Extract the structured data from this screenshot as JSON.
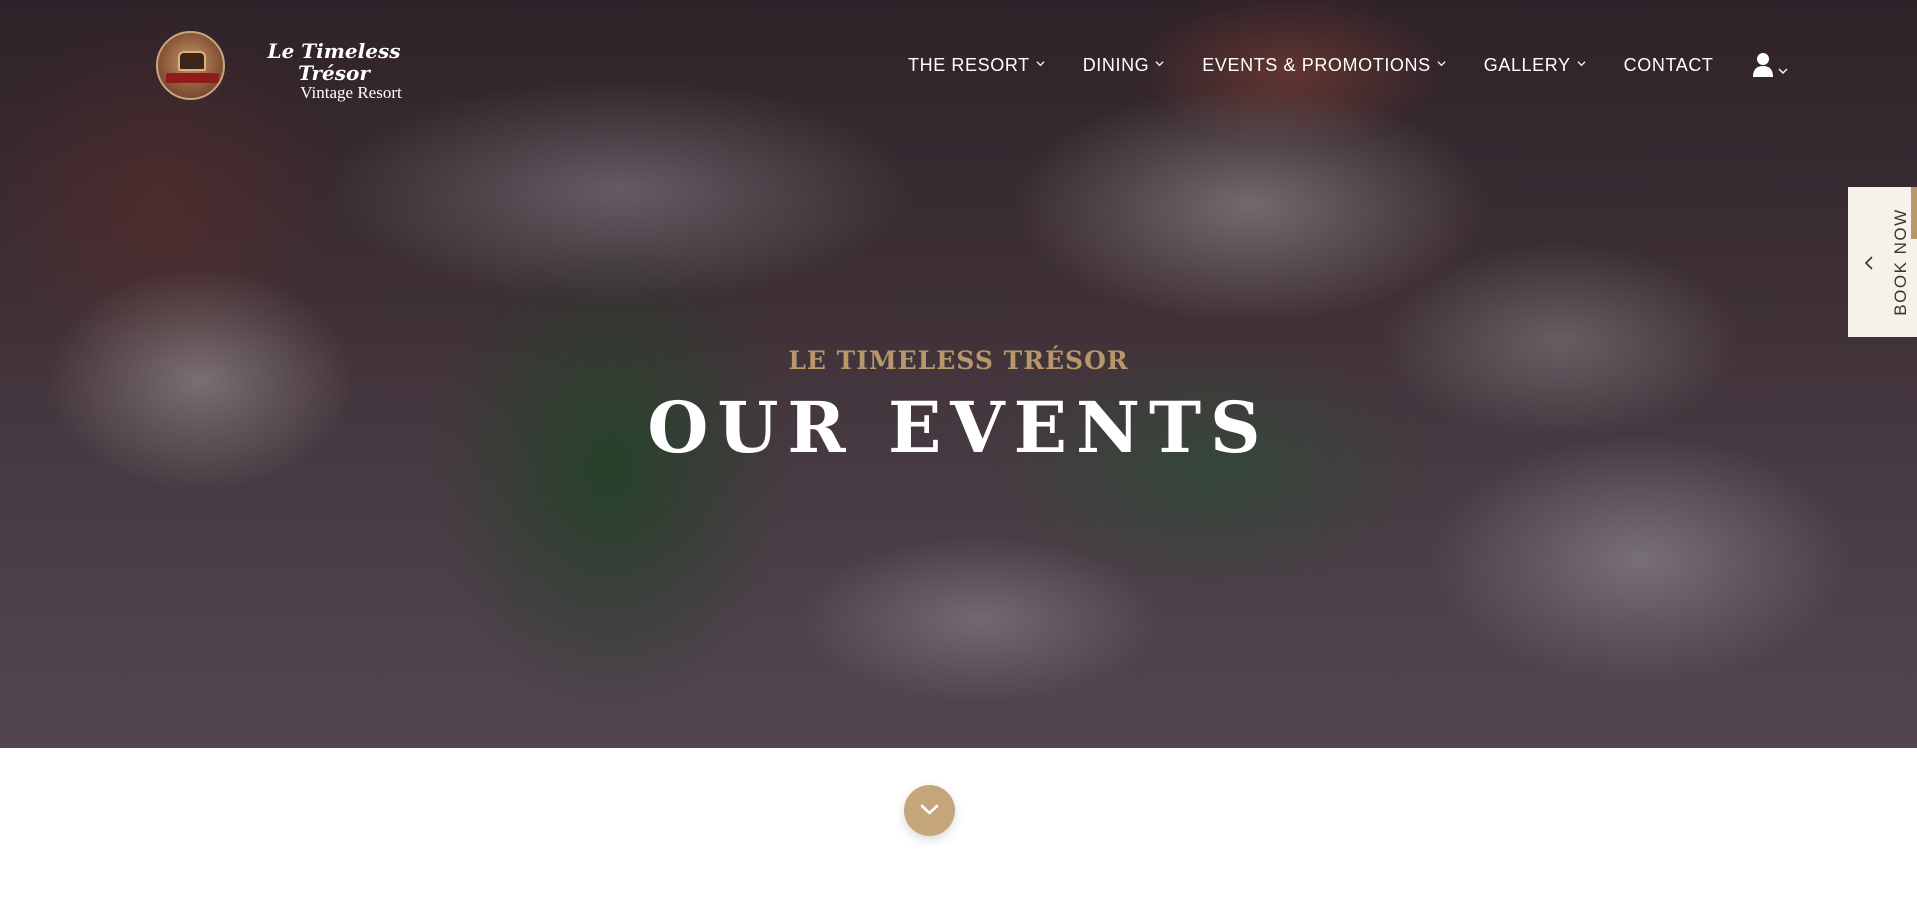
{
  "brand": {
    "name": "Le Timeless Trésor",
    "subtitle": "Vintage Resort",
    "logo_text": "Le Timeless Trésor"
  },
  "nav": {
    "items": [
      {
        "label": "THE RESORT",
        "has_dropdown": true
      },
      {
        "label": "DINING",
        "has_dropdown": true
      },
      {
        "label": "EVENTS & PROMOTIONS",
        "has_dropdown": true
      },
      {
        "label": "GALLERY",
        "has_dropdown": true
      },
      {
        "label": "CONTACT",
        "has_dropdown": false
      }
    ],
    "user_icon": "user-icon"
  },
  "hero": {
    "eyebrow": "LE TIMELESS TRÉSOR",
    "title": "OUR EVENTS"
  },
  "book_now": {
    "label": "BOOK NOW",
    "icon": "chevron-left-icon"
  },
  "scroll_down": {
    "icon": "chevron-down-icon"
  },
  "colors": {
    "accent": "#b8986a",
    "scroll_button": "#c5a57a",
    "book_tab_bg": "#f6f1ea",
    "white": "#ffffff"
  }
}
